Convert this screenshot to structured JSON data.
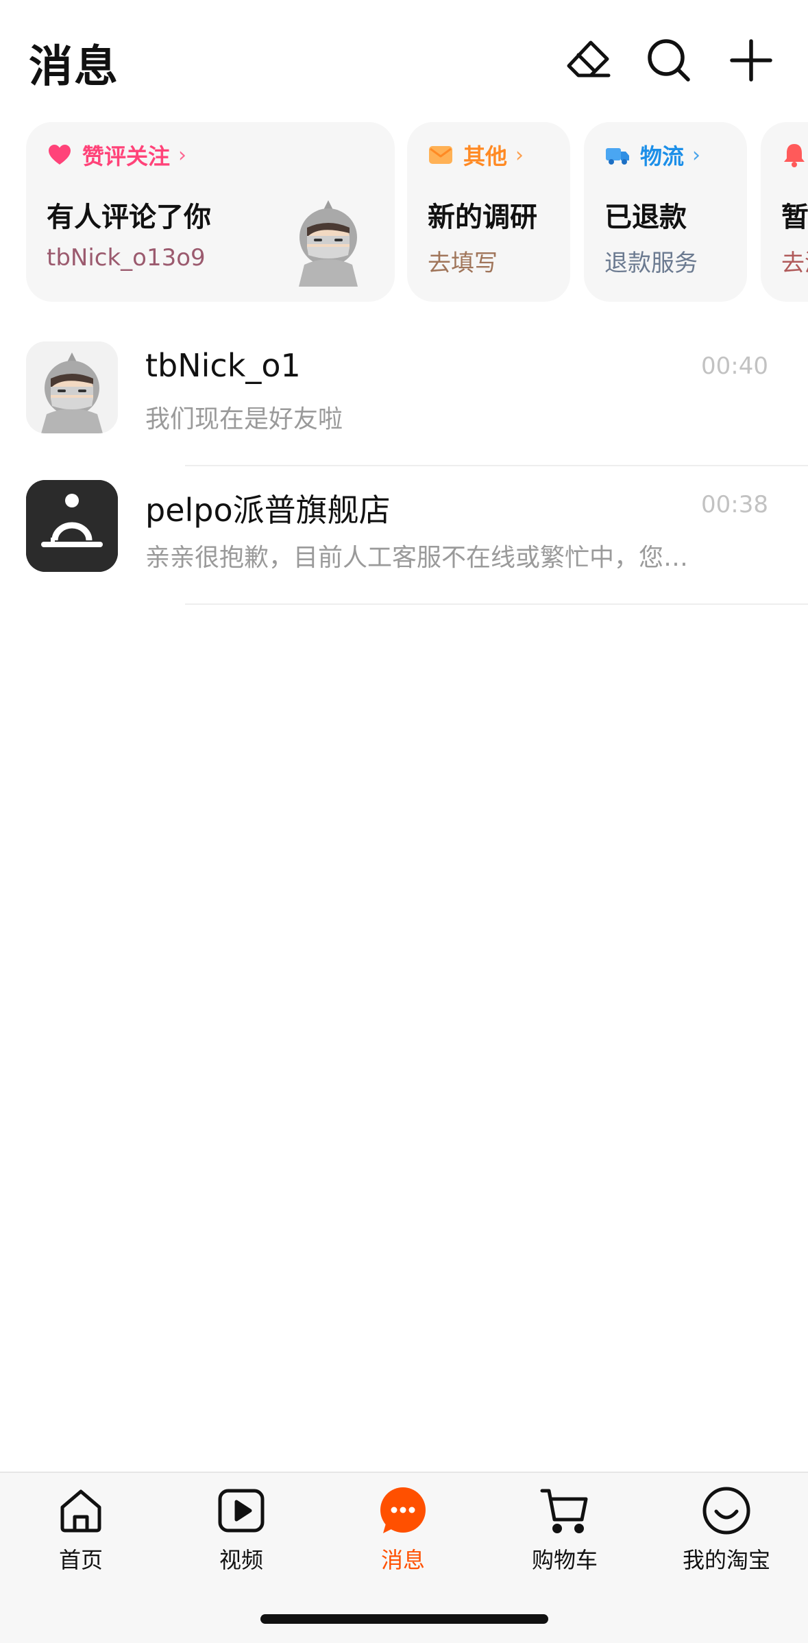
{
  "header": {
    "title": "消息",
    "icons": [
      "eraser-icon",
      "search-icon",
      "plus-icon"
    ]
  },
  "cards": [
    {
      "tag": "赞评关注",
      "tag_icon": "heart-icon",
      "tag_color": "#ff4379",
      "title": "有人评论了你",
      "subtitle": "tbNick_o13o9",
      "subtitle_color": "#9b5a6e"
    },
    {
      "tag": "其他",
      "tag_icon": "mail-icon",
      "tag_color": "#ff8a24",
      "title": "新的调研",
      "subtitle": "去填写",
      "subtitle_color": "#a0755a"
    },
    {
      "tag": "物流",
      "tag_icon": "truck-icon",
      "tag_color": "#1c8fe8",
      "title": "已退款",
      "subtitle": "退款服务",
      "subtitle_color": "#6b7a90"
    },
    {
      "tag": "",
      "tag_icon": "bell-icon",
      "tag_color": "#ff4d4d",
      "title": "暂",
      "subtitle": "去添",
      "subtitle_color": "#b05a5a"
    }
  ],
  "conversations": [
    {
      "name": "tbNick_o1",
      "time": "00:40",
      "preview": "我们现在是好友啦",
      "avatar": "ninja-avatar"
    },
    {
      "name": "pelpo派普旗舰店",
      "time": "00:38",
      "preview": "亲亲很抱歉，目前人工客服不在线或繁忙中，您…",
      "avatar": "store-logo"
    }
  ],
  "tabs": [
    {
      "label": "首页",
      "icon": "home-icon",
      "active": false
    },
    {
      "label": "视频",
      "icon": "video-icon",
      "active": false
    },
    {
      "label": "消息",
      "icon": "message-icon",
      "active": true
    },
    {
      "label": "购物车",
      "icon": "cart-icon",
      "active": false
    },
    {
      "label": "我的淘宝",
      "icon": "smile-icon",
      "active": false
    }
  ],
  "colors": {
    "accent": "#ff5000",
    "card_bg": "#f6f6f6",
    "muted_text": "#9a9a9a",
    "time_text": "#c2c2c2"
  }
}
